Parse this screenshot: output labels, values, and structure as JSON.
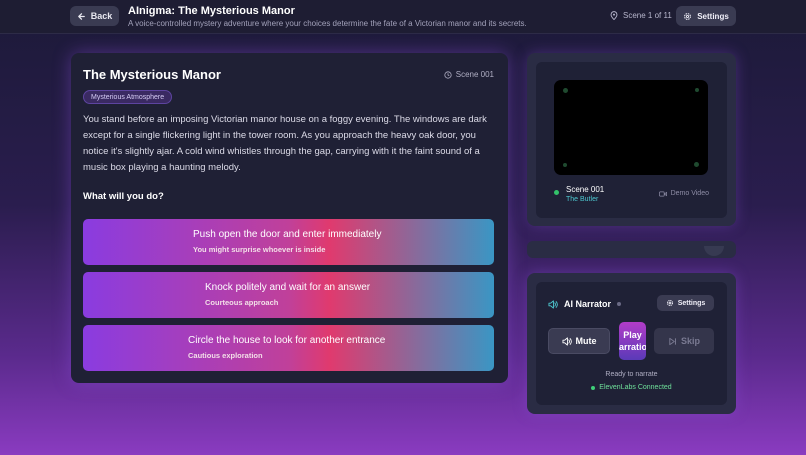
{
  "header": {
    "back_label": "Back",
    "title": "AInigma: The Mysterious Manor",
    "subtitle": "A voice-controlled mystery adventure where your choices determine the fate of a Victorian manor and its secrets.",
    "scene_count": "Scene 1 of 11",
    "settings_label": "Settings"
  },
  "story": {
    "title": "The Mysterious Manor",
    "scene_label": "Scene 001",
    "badge": "Mysterious Atmosphere",
    "text": "You stand before an imposing Victorian manor house on a foggy evening. The windows are dark except for a single flickering light in the tower room. As you approach the heavy oak door, you notice it's slightly ajar. A cold wind whistles through the gap, carrying with it the faint sound of a music box playing a haunting melody.",
    "prompt": "What will you do?",
    "choices": [
      {
        "title": "Push open the door and enter immediately",
        "subtitle": "You might surprise whoever is inside"
      },
      {
        "title": "Knock politely and wait for an answer",
        "subtitle": "Courteous approach"
      },
      {
        "title": "Circle the house to look for another entrance",
        "subtitle": "Cautious exploration"
      }
    ]
  },
  "video": {
    "scene": "Scene 001",
    "character": "The Butler",
    "demo_label": "Demo Video"
  },
  "narrator": {
    "title": "AI Narrator",
    "settings_label": "Settings",
    "mute_label": "Mute",
    "play_line1": "Play",
    "play_line2": "Narration",
    "skip_label": "Skip",
    "status": "Ready to narrate",
    "connection": "ElevenLabs Connected"
  },
  "colors": {
    "accent_purple": "#8a3ce0",
    "accent_pink": "#e03a6e",
    "accent_teal": "#3a96c4",
    "status_green": "#33c26a",
    "character_teal": "#4ec8d0"
  }
}
